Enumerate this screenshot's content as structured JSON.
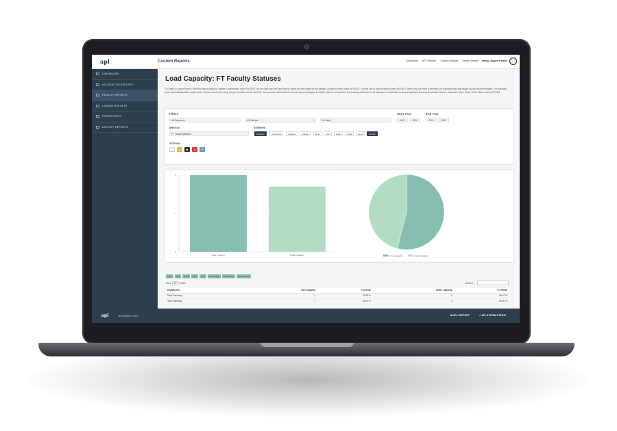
{
  "app": {
    "logo": "apl",
    "title": "Custom Reports"
  },
  "topnav": [
    "Dashboard",
    "APL Reports",
    "Custom Reports",
    "Saved Reports"
  ],
  "user": {
    "greeting": "Hello, Super Admin"
  },
  "sidebar": {
    "items": [
      {
        "label": "DASHBOARD"
      },
      {
        "label": "ACCREDITOR REPORTS"
      },
      {
        "label": "FACULTY REPORTS"
      },
      {
        "label": "COURSE REPORTS"
      },
      {
        "label": "FOS REPORTS"
      },
      {
        "label": "ACTIVITY REPORTS"
      }
    ]
  },
  "page": {
    "title": "Load Capacity: FT Faculty Statuses",
    "description": "To Create a Custom Report: Filter the data by campus, college or department under FILTERS. Set the Start and End Year fields to select the date range for the dataset. Choose a metric under METRICS. Choose one or many indexes under INDEXES. When only one index is selected, the summary table will display counts and percentages. The summary report automatically hides empty fields, but you can set hide using the green buttons above the table. You can also hide/unhide the counts and percentages. If multiple indexes are selected, the summary table will not be displayed. A detail table is always displayed showing all selected indexes. Download, Save, Share, Clear Filters under ACTIONS."
  },
  "filters": {
    "label": "Filters",
    "campus": "All Campuses",
    "college": "All Colleges",
    "dept": "All Depts",
    "start_year_label": "Start Year",
    "end_year_label": "End Year",
    "start_from": "2020",
    "start_to": "2021",
    "end_from": "2020",
    "end_to": "2021",
    "metrics_label": "Metrics",
    "metric": "FT Faculty Statuses",
    "indexes_label": "Indexes",
    "indexes": [
      "Capacity",
      "Inst Series",
      "Campus",
      "College",
      "Dept",
      "Year",
      "Rank",
      "Track",
      "Level",
      "Gender"
    ],
    "actions_label": "Actions"
  },
  "chart_data": [
    {
      "type": "bar",
      "categories": [
        "Over Capacity",
        "Under Capacity"
      ],
      "values": [
        2,
        1.7
      ],
      "ylim": [
        0,
        2
      ],
      "yticks": [
        "0",
        "1",
        "2"
      ],
      "colors": [
        "#86bfb2",
        "#b2dcc1"
      ]
    },
    {
      "type": "pie",
      "labels": [
        "Over Capacity",
        "Under Capacity"
      ],
      "values": [
        54,
        46
      ],
      "colors": [
        "#86bfb2",
        "#b2dcc1"
      ],
      "legend": "bottom"
    }
  ],
  "exports": [
    "Copy",
    "CSV",
    "Excel",
    "PDF",
    "Print",
    "Show empty",
    "Hide counts",
    "Hide percents"
  ],
  "table": {
    "show_label": "Show",
    "show_value": "10",
    "entries_label": "entries",
    "search_label": "Search:",
    "headers": [
      "Department",
      "Over Capacity",
      "% Overall",
      "Under Capacity",
      "% Overall"
    ],
    "rows": [
      [
        "Total Summary",
        "2",
        "33.33 %",
        "4",
        "66.67 %"
      ],
      [
        "Total Summary",
        "1",
        "50.00 %",
        "3",
        "50.00 %"
      ]
    ]
  },
  "footer": {
    "logo": "apl",
    "copyright": "Apl nextED © 2021",
    "support": "APL SUPPORT",
    "status": "APL SYSTEM STATUS"
  }
}
